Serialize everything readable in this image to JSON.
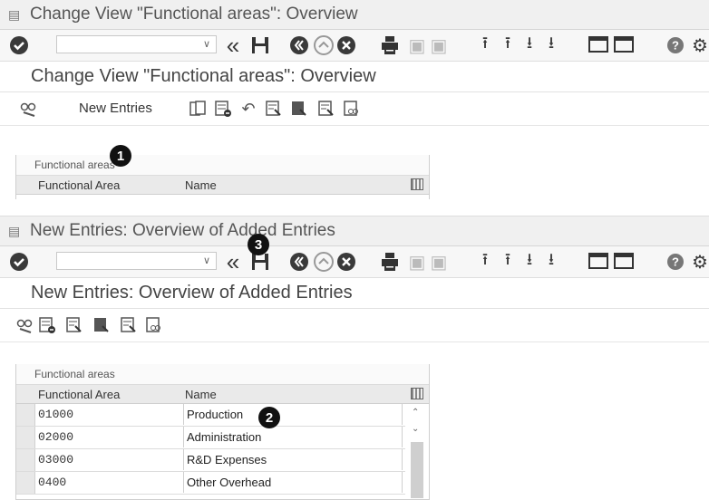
{
  "top_window": {
    "title": "Change View \"Functional areas\": Overview",
    "subtitle": "Change View \"Functional areas\": Overview",
    "new_entries_label": "New Entries",
    "table": {
      "title": "Functional areas",
      "col1": "Functional Area",
      "col2": "Name"
    }
  },
  "bottom_window": {
    "title": "New Entries: Overview of Added Entries",
    "subtitle": "New Entries: Overview of Added Entries",
    "table": {
      "title": "Functional areas",
      "col1": "Functional Area",
      "col2": "Name",
      "rows": [
        {
          "code": "01000",
          "name": "Production"
        },
        {
          "code": "02000",
          "name": "Administration"
        },
        {
          "code": "03000",
          "name": "R&D Expenses"
        },
        {
          "code": "0400",
          "name": "Other Overhead"
        }
      ]
    }
  },
  "callouts": [
    "1",
    "2",
    "3"
  ],
  "icons": [
    "check-icon",
    "back-double-icon",
    "save-icon",
    "back-icon",
    "exit-icon",
    "cancel-icon",
    "print-icon",
    "find-icon",
    "find-next-icon",
    "first-page-icon",
    "prev-page-icon",
    "next-page-icon",
    "last-page-icon",
    "new-session-icon",
    "shortcut-icon",
    "help-icon",
    "settings-icon"
  ],
  "colors": {
    "toolbar_bg": "#f7f7f7",
    "titlebar_bg": "#f0f0f0",
    "badge": "#111111"
  }
}
